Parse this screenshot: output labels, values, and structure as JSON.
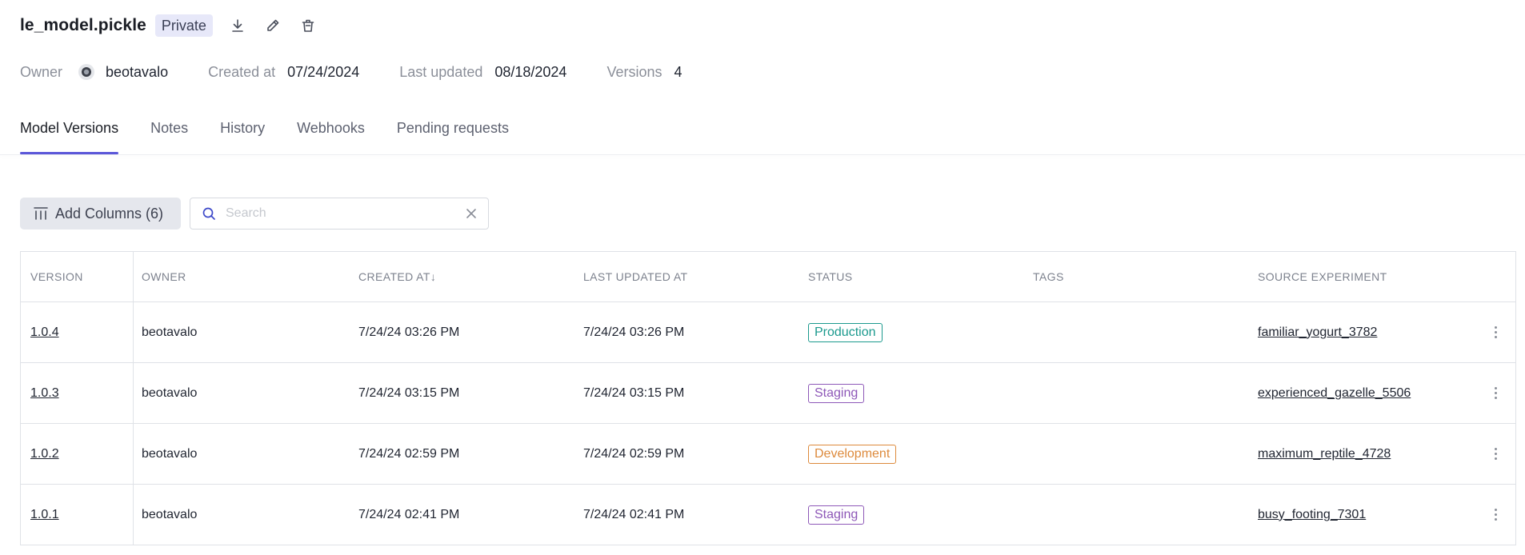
{
  "header": {
    "title": "le_model.pickle",
    "visibility": "Private",
    "icons": [
      "download-icon",
      "edit-icon",
      "delete-icon"
    ]
  },
  "meta": {
    "owner_label": "Owner",
    "owner": "beotavalo",
    "created_label": "Created at",
    "created": "07/24/2024",
    "updated_label": "Last updated",
    "updated": "08/18/2024",
    "versions_label": "Versions",
    "versions": "4"
  },
  "tabs": [
    {
      "label": "Model Versions",
      "active": true
    },
    {
      "label": "Notes"
    },
    {
      "label": "History"
    },
    {
      "label": "Webhooks"
    },
    {
      "label": "Pending requests"
    }
  ],
  "toolbar": {
    "add_columns_label": "Add Columns (6)",
    "search_placeholder": "Search"
  },
  "table": {
    "columns": [
      "VERSION",
      "OWNER",
      "CREATED AT",
      "LAST UPDATED AT",
      "STATUS",
      "TAGS",
      "SOURCE EXPERIMENT"
    ],
    "sort_indicator": "↓",
    "rows": [
      {
        "version": "1.0.4",
        "owner": "beotavalo",
        "created": "7/24/24 03:26 PM",
        "updated": "7/24/24 03:26 PM",
        "status": "Production",
        "tags": "",
        "source": "familiar_yogurt_3782"
      },
      {
        "version": "1.0.3",
        "owner": "beotavalo",
        "created": "7/24/24 03:15 PM",
        "updated": "7/24/24 03:15 PM",
        "status": "Staging",
        "tags": "",
        "source": "experienced_gazelle_5506"
      },
      {
        "version": "1.0.2",
        "owner": "beotavalo",
        "created": "7/24/24 02:59 PM",
        "updated": "7/24/24 02:59 PM",
        "status": "Development",
        "tags": "",
        "source": "maximum_reptile_4728"
      },
      {
        "version": "1.0.1",
        "owner": "beotavalo",
        "created": "7/24/24 02:41 PM",
        "updated": "7/24/24 02:41 PM",
        "status": "Staging",
        "tags": "",
        "source": "busy_footing_7301"
      }
    ]
  },
  "colors": {
    "accent": "#5b57d9",
    "Production": "#1c9a8e",
    "Staging": "#8e58b8",
    "Development": "#dd8a3c"
  }
}
